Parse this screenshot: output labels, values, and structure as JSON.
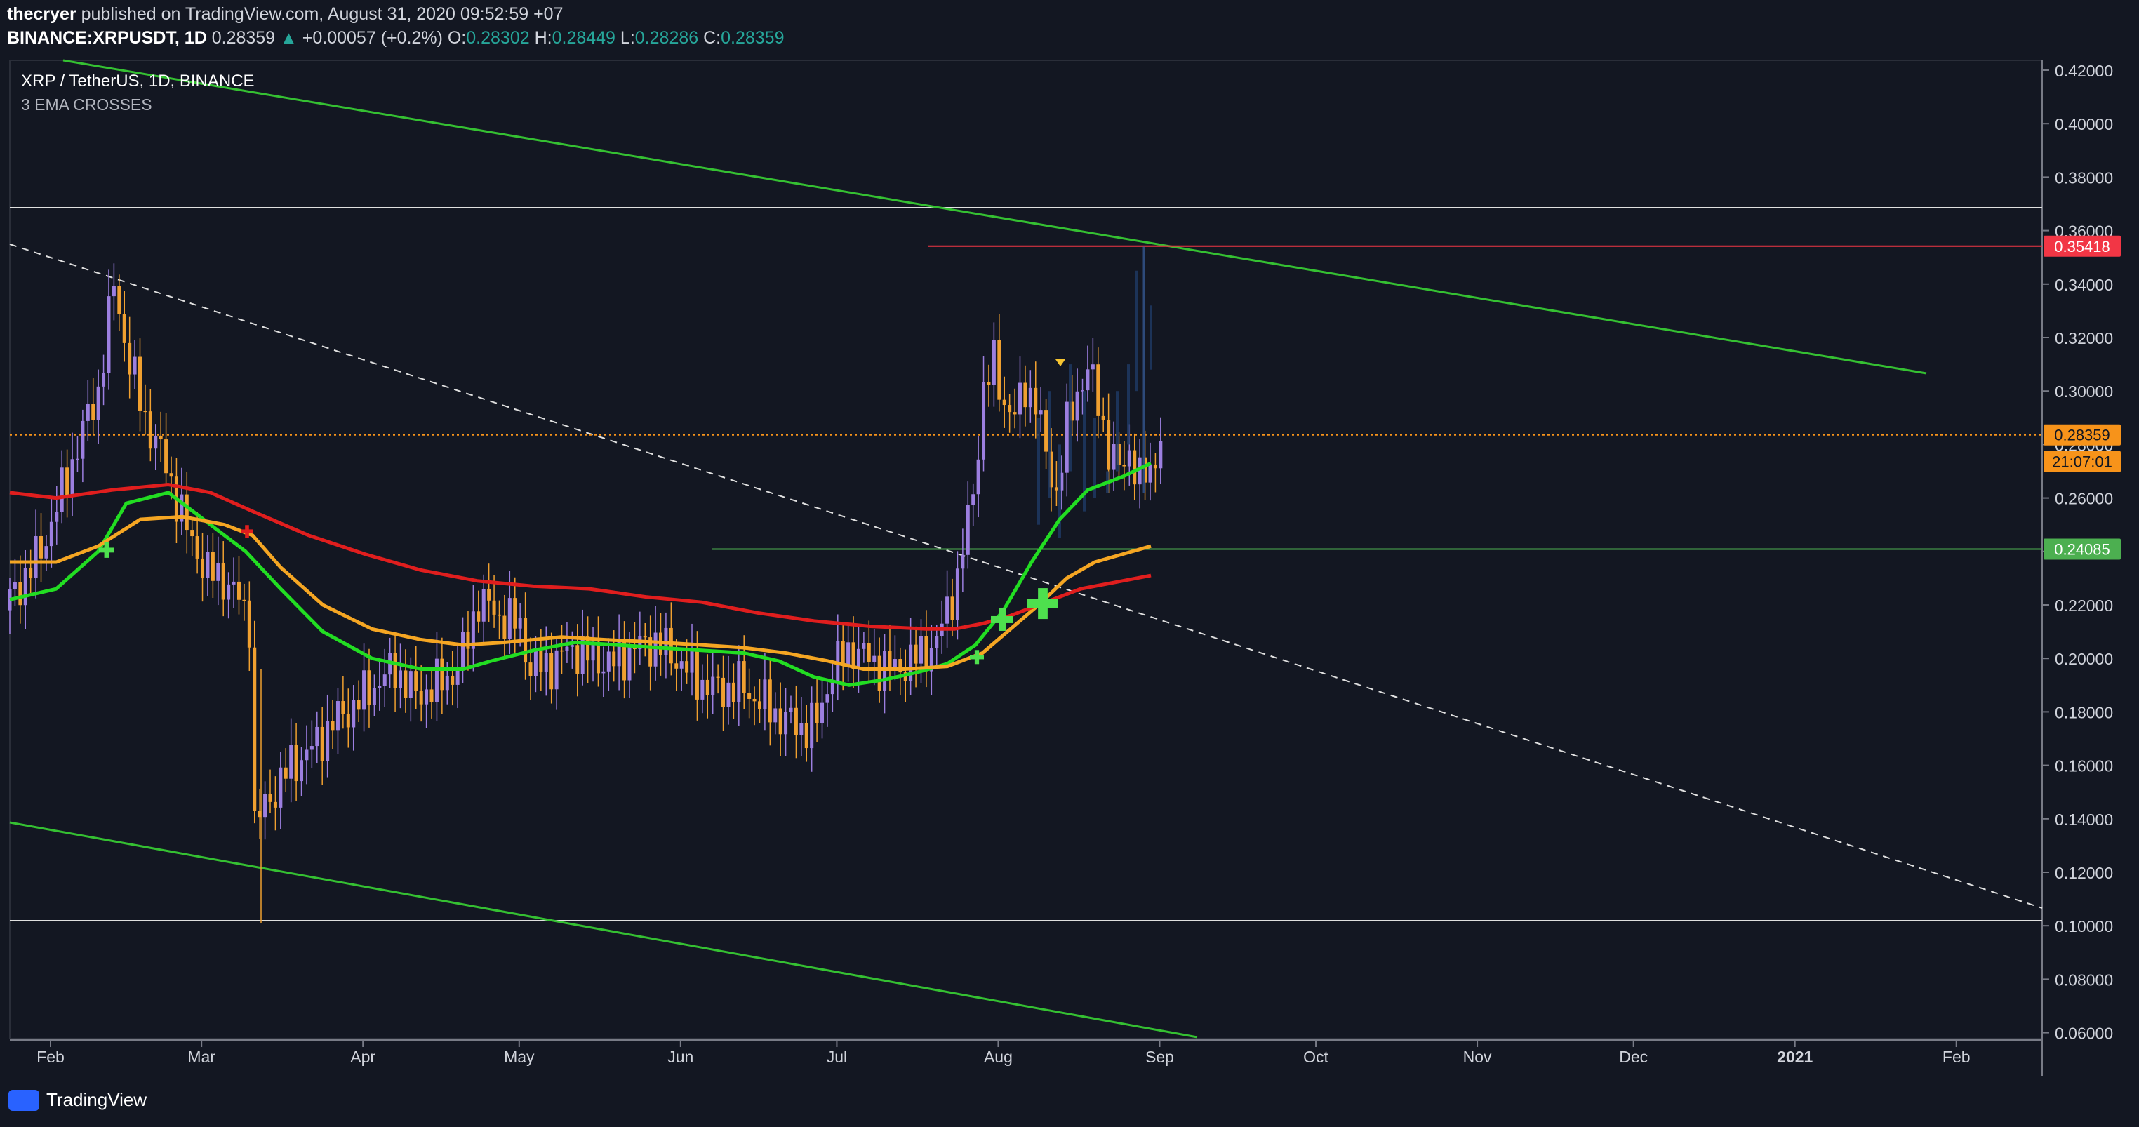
{
  "publish": {
    "author": "thecryer",
    "text": "published on TradingView.com, August 31, 2020 09:52:59 +07"
  },
  "quote": {
    "symbol": "BINANCE:XRPUSDT, 1D",
    "last": "0.28359",
    "arrow": "▲",
    "change": "+0.00057 (+0.2%)",
    "o_label": "O:",
    "o": "0.28302",
    "h_label": "H:",
    "h": "0.28449",
    "l_label": "L:",
    "l": "0.28286",
    "c_label": "C:",
    "c": "0.28359"
  },
  "legend": {
    "title": "XRP / TetherUS, 1D, BINANCE",
    "study": "3 EMA CROSSES"
  },
  "price_axis": {
    "ticks": [
      "0.42000",
      "0.40000",
      "0.38000",
      "0.36000",
      "0.34000",
      "0.32000",
      "0.30000",
      "0.28000",
      "0.26000",
      "0.24000",
      "0.22000",
      "0.20000",
      "0.18000",
      "0.16000",
      "0.14000",
      "0.12000",
      "0.10000",
      "0.08000",
      "0.06000"
    ],
    "resistance_label": "0.35418",
    "current_label": "0.28359",
    "countdown_label": "21:07:01",
    "support_label": "0.24085"
  },
  "time_axis": {
    "labels": [
      "Feb",
      "Mar",
      "Apr",
      "May",
      "Jun",
      "Jul",
      "Aug",
      "Sep",
      "Oct",
      "Nov",
      "Dec",
      "2021",
      "Feb"
    ]
  },
  "colors": {
    "background": "#131722",
    "up_candle": "#9c7fe0",
    "down_candle": "#f0a030",
    "ema_fast": "#22dd22",
    "ema_mid": "#f5a623",
    "ema_slow": "#e01e1e",
    "channel": "#35c032",
    "resistance": "#f23645",
    "support": "#4caf50",
    "current": "#f7931a"
  },
  "footer": {
    "brand": "TradingView"
  }
}
